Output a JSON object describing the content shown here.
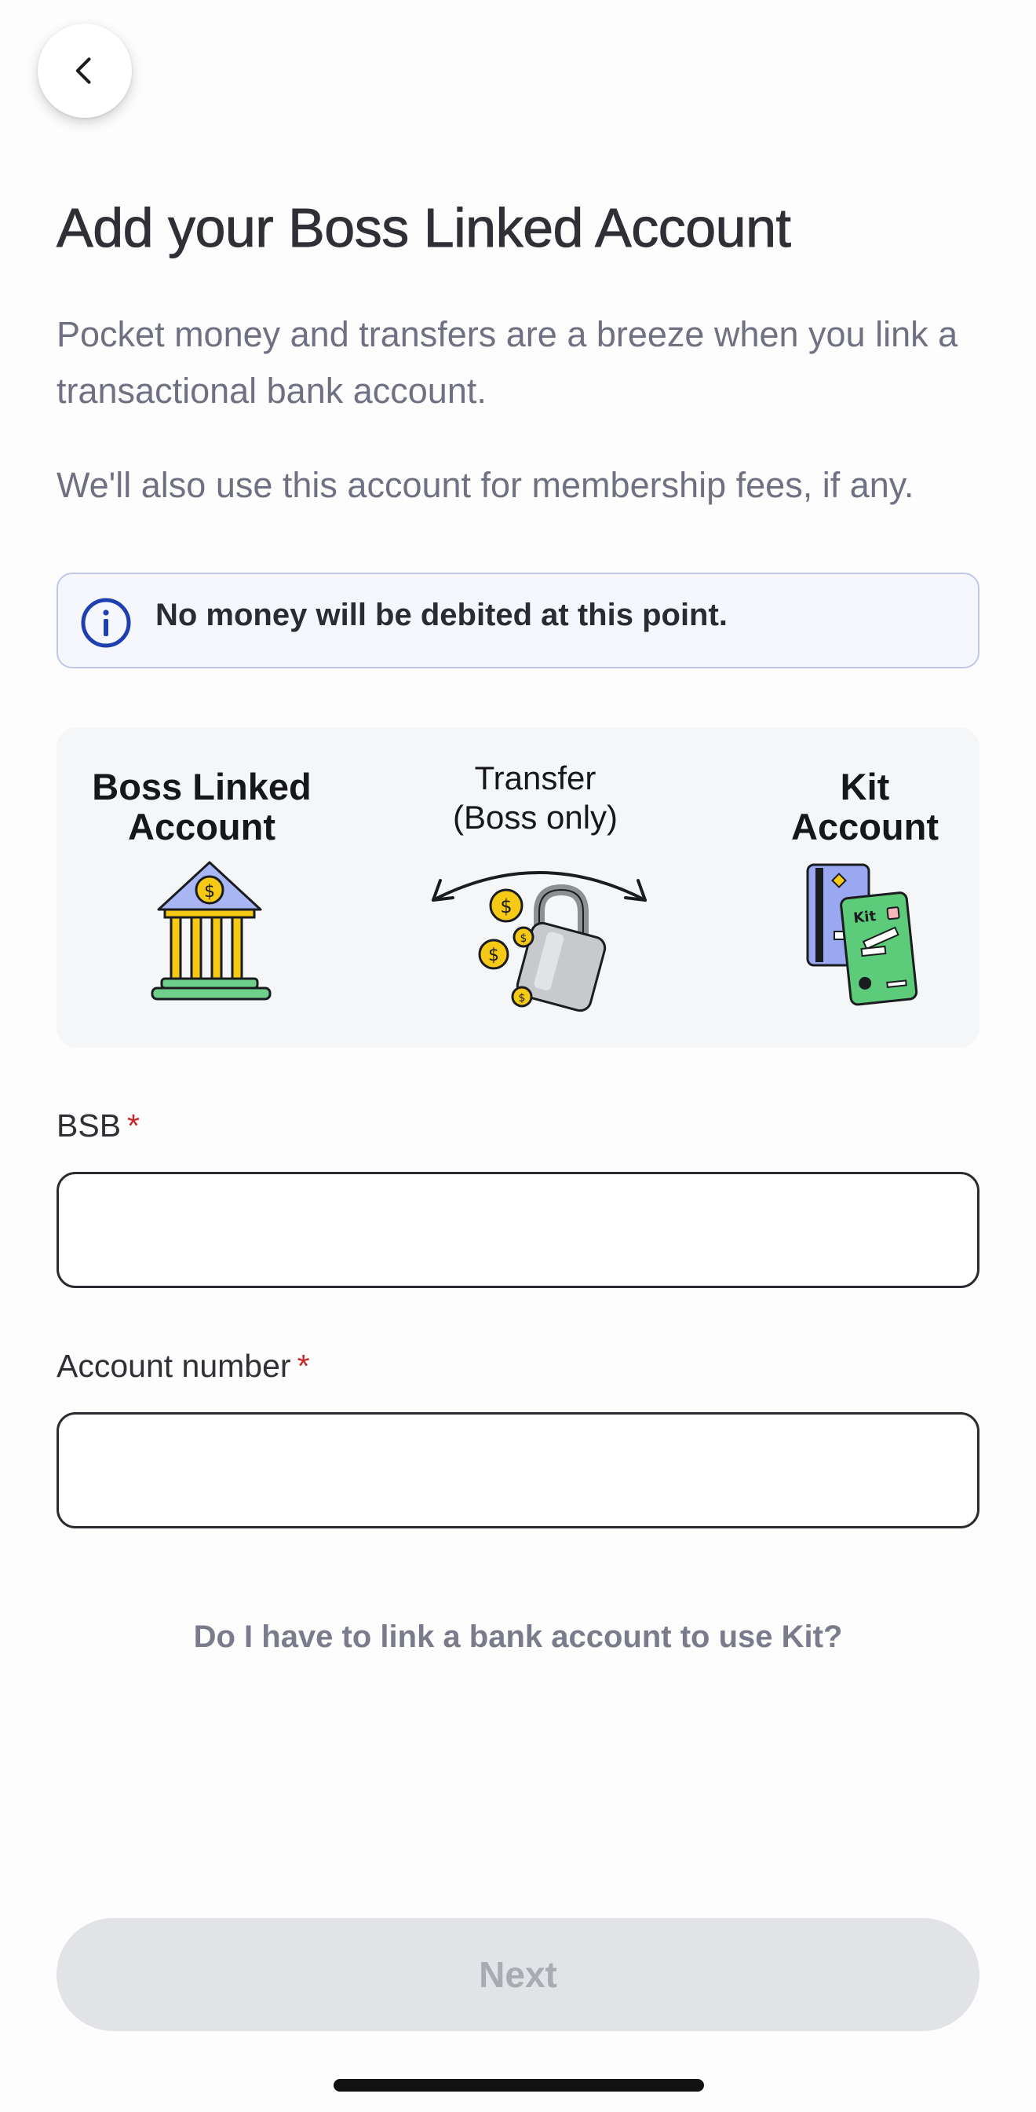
{
  "header": {
    "back_icon": "chevron-left-icon"
  },
  "page": {
    "title": "Add your Boss Linked Account",
    "description_1": "Pocket money and transfers are a breeze when you link a transactional bank account.",
    "description_2": "We'll also use this account for membership fees, if any."
  },
  "info_banner": {
    "icon": "info-icon",
    "text": "No money will be debited at this point."
  },
  "illustration": {
    "left_label_line1": "Boss Linked",
    "left_label_line2": "Account",
    "center_label_line1": "Transfer",
    "center_label_line2": "(Boss only)",
    "right_label_line1": "Kit",
    "right_label_line2": "Account",
    "card_text": "Kit",
    "colors": {
      "bank_roof": "#a9b6f5",
      "coin": "#f6c915",
      "pillar": "#f6c915",
      "base": "#6fd08c",
      "card_blue": "#9aa8f2",
      "card_green": "#5ccb7a"
    }
  },
  "form": {
    "bsb_label": "BSB",
    "bsb_required_mark": "*",
    "bsb_value": "",
    "account_label": "Account number",
    "account_required_mark": "*",
    "account_value": ""
  },
  "help_link": "Do I have to link a bank account to use Kit?",
  "footer": {
    "next_label": "Next"
  },
  "colors": {
    "info_icon": "#1e3fb0",
    "required": "#c62828",
    "disabled_button_bg": "#e2e3e6",
    "disabled_button_text": "#a9aab2"
  }
}
